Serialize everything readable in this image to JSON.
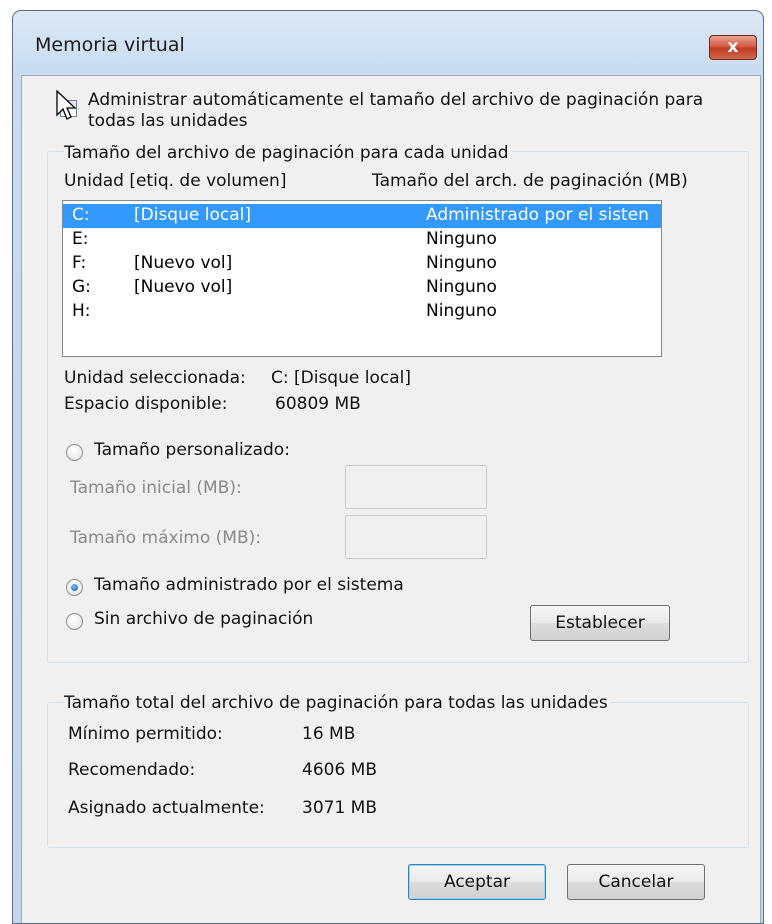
{
  "dialog": {
    "title": "Memoria virtual",
    "close_label": "x"
  },
  "auto_manage": {
    "label_line1": "Administrar automáticamente el tamaño del archivo de paginación para",
    "label_line2": "todas las unidades",
    "checked": false
  },
  "per_drive_group": {
    "legend": "Tamaño del archivo de paginación para cada unidad",
    "col_drive": "Unidad [etiq. de volumen]",
    "col_size": "Tamaño del arch. de paginación (MB)",
    "drives": [
      {
        "letter": "C:",
        "label": "[Disque local]",
        "size": "Administrado por el sisten",
        "selected": true
      },
      {
        "letter": "E:",
        "label": "",
        "size": "Ninguno",
        "selected": false
      },
      {
        "letter": "F:",
        "label": "[Nuevo vol]",
        "size": "Ninguno",
        "selected": false
      },
      {
        "letter": "G:",
        "label": "[Nuevo vol]",
        "size": "Ninguno",
        "selected": false
      },
      {
        "letter": "H:",
        "label": "",
        "size": "Ninguno",
        "selected": false
      }
    ],
    "selected_drive_label": "Unidad seleccionada:",
    "selected_drive_value": "C:  [Disque local]",
    "available_space_label": "Espacio disponible:",
    "available_space_value": "60809 MB",
    "custom_size_label": "Tamaño personalizado:",
    "initial_size_label": "Tamaño inicial (MB):",
    "max_size_label": "Tamaño máximo (MB):",
    "initial_size_value": "",
    "max_size_value": "",
    "system_managed_label": "Tamaño administrado por el sistema",
    "no_paging_label": "Sin archivo de paginación",
    "selected_option": "system_managed",
    "set_button": "Establecer"
  },
  "total_group": {
    "legend": "Tamaño total del archivo de paginación para todas las unidades",
    "min_label": "Mínimo permitido:",
    "min_value": "16 MB",
    "recommended_label": "Recomendado:",
    "recommended_value": "4606 MB",
    "current_label": "Asignado actualmente:",
    "current_value": "3071 MB"
  },
  "buttons": {
    "ok": "Aceptar",
    "cancel": "Cancelar"
  }
}
